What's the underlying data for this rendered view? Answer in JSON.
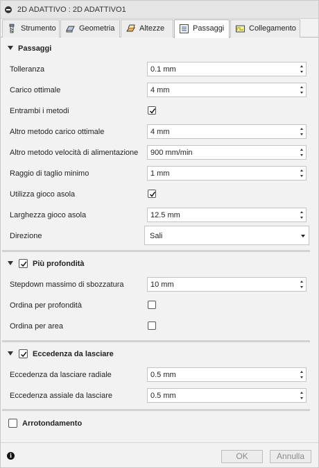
{
  "window": {
    "title": "2D ADATTIVO : 2D ADATTIVO1"
  },
  "tabs": [
    {
      "label": "Strumento",
      "icon": "tool-icon"
    },
    {
      "label": "Geometria",
      "icon": "geometry-icon"
    },
    {
      "label": "Altezze",
      "icon": "heights-icon"
    },
    {
      "label": "Passaggi",
      "icon": "passes-icon",
      "active": true
    },
    {
      "label": "Collegamento",
      "icon": "linking-icon"
    }
  ],
  "passaggi": {
    "title": "Passaggi",
    "tolleranza": {
      "label": "Tolleranza",
      "value": "0.1 mm"
    },
    "carico_ottimale": {
      "label": "Carico ottimale",
      "value": "4 mm"
    },
    "entrambi_metodi": {
      "label": "Entrambi i metodi",
      "checked": true
    },
    "altro_carico": {
      "label": "Altro metodo carico ottimale",
      "value": "4 mm"
    },
    "altro_velocita": {
      "label": "Altro metodo velocità di alimentazione",
      "value": "900 mm/min"
    },
    "raggio_taglio": {
      "label": "Raggio di taglio minimo",
      "value": "1 mm"
    },
    "gioco_asola": {
      "label": "Utilizza gioco asola",
      "checked": true
    },
    "larghezza_asola": {
      "label": "Larghezza gioco asola",
      "value": "12.5 mm"
    },
    "direzione": {
      "label": "Direzione",
      "value": "Sali"
    }
  },
  "profondita": {
    "title": "Più profondità",
    "checked": true,
    "stepdown": {
      "label": "Stepdown massimo di sbozzatura",
      "value": "10 mm"
    },
    "ordina_profondita": {
      "label": "Ordina per profondità",
      "checked": false
    },
    "ordina_area": {
      "label": "Ordina per area",
      "checked": false
    }
  },
  "eccedenza": {
    "title": "Eccedenza da lasciare",
    "checked": true,
    "radiale": {
      "label": "Eccedenza da lasciare radiale",
      "value": "0.5 mm"
    },
    "assiale": {
      "label": "Eccedenza assiale da lasciare",
      "value": "0.5 mm"
    }
  },
  "arrotondamento": {
    "title": "Arrotondamento",
    "checked": false
  },
  "footer": {
    "ok_label": "OK",
    "cancel_label": "Annulla",
    "info_glyph": "i"
  },
  "colors": {
    "tab_active_bg": "#ffffff",
    "panel_bg": "#f2f2f2",
    "disabled_text": "#8a8a8a"
  }
}
